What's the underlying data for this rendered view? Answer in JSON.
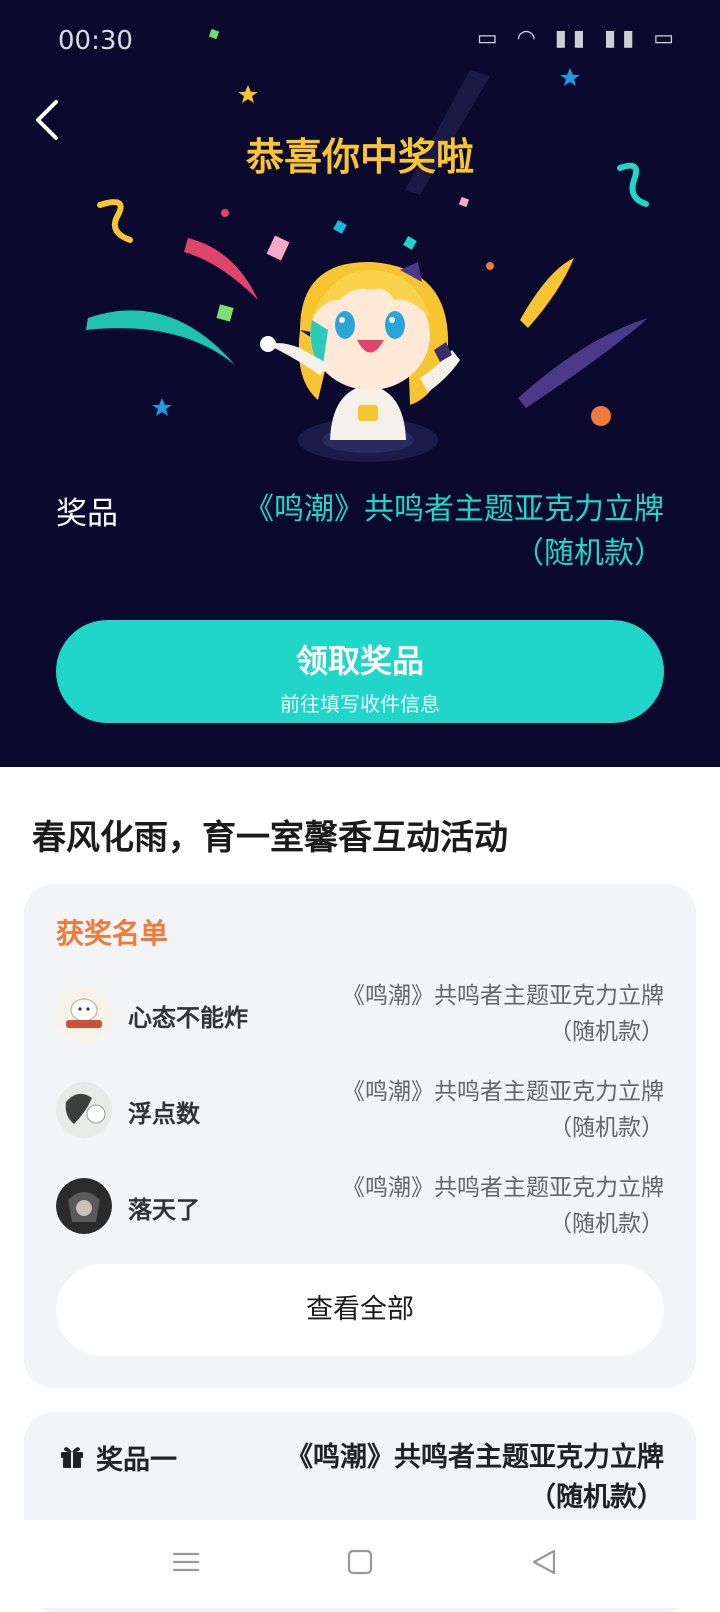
{
  "status_bar": {
    "time": "00:30"
  },
  "header": {
    "congrats_title": "恭喜你中奖啦"
  },
  "prize": {
    "label": "奖品",
    "name": "《鸣潮》共鸣者主题亚克力立牌（随机款）"
  },
  "claim_button": {
    "label": "领取奖品",
    "sublabel": "前往填写收件信息"
  },
  "activity": {
    "title": "春风化雨，育一室馨香互动活动"
  },
  "winners": {
    "section_title": "获奖名单",
    "items": [
      {
        "name": "心态不能炸",
        "prize": "《鸣潮》共鸣者主题亚克力立牌（随机款）"
      },
      {
        "name": "浮点数",
        "prize": "《鸣潮》共鸣者主题亚克力立牌（随机款）"
      },
      {
        "name": "落天了",
        "prize": "《鸣潮》共鸣者主题亚克力立牌（随机款）"
      }
    ],
    "view_all_label": "查看全部"
  },
  "prize_list": {
    "items": [
      {
        "label": "奖品一",
        "name": "《鸣潮》共鸣者主题亚克力立牌（随机款）"
      }
    ]
  },
  "icons": {
    "back": "back-icon",
    "gift": "gift-icon",
    "nav_menu": "menu-icon",
    "nav_home": "home-icon",
    "nav_back": "nav-back-icon"
  },
  "colors": {
    "hero_bg": "#0b0a2e",
    "accent_teal": "#1fd6c8",
    "title_gold": "#f7c531",
    "winners_title_orange": "#f07a3a",
    "card_bg": "#f3f4f6"
  }
}
